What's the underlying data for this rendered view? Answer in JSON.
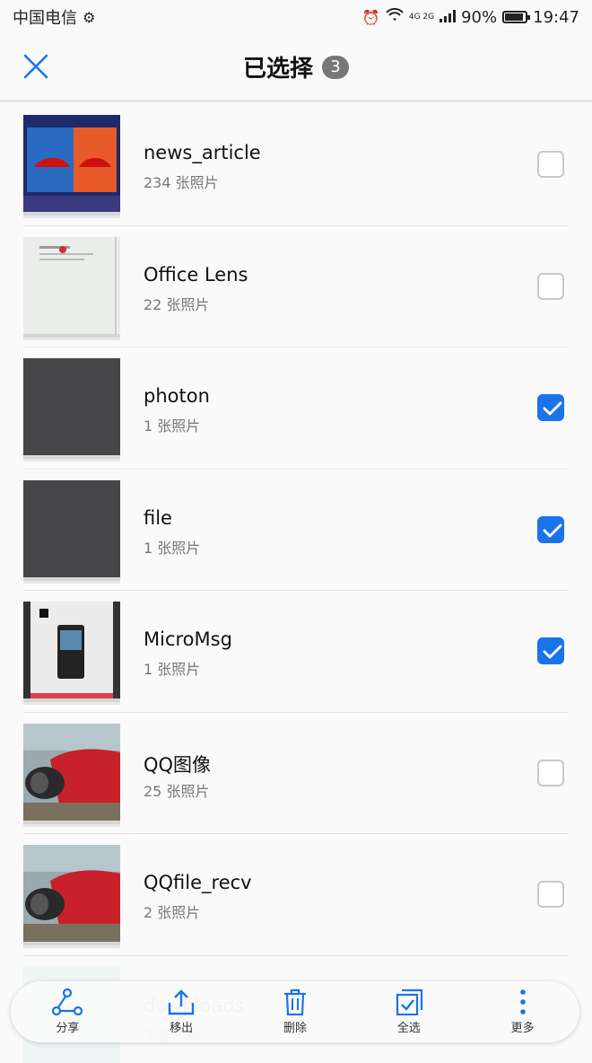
{
  "status_bar": {
    "carrier": "中国电信",
    "network": "4G 2G",
    "battery": "90%",
    "battery_level": 0.9,
    "time": "19:47"
  },
  "header": {
    "title": "已选择",
    "selected_count": "3"
  },
  "albums": [
    {
      "name": "news_article",
      "count": "234 张照片",
      "checked": false,
      "thumb": "car-expo"
    },
    {
      "name": "Office Lens",
      "count": "22 张照片",
      "checked": false,
      "thumb": "document"
    },
    {
      "name": "photon",
      "count": "1 张照片",
      "checked": true,
      "thumb": "dark"
    },
    {
      "name": "file",
      "count": "1 张照片",
      "checked": true,
      "thumb": "dark"
    },
    {
      "name": "MicroMsg",
      "count": "1 张照片",
      "checked": true,
      "thumb": "phone"
    },
    {
      "name": "QQ图像",
      "count": "25 张照片",
      "checked": false,
      "thumb": "red-car"
    },
    {
      "name": "QQfile_recv",
      "count": "2 张照片",
      "checked": false,
      "thumb": "red-car"
    },
    {
      "name": "downloads",
      "count": "3 张照片",
      "checked": false,
      "thumb": "partial"
    }
  ],
  "bottom_bar": {
    "share": "分享",
    "move_out": "移出",
    "delete": "删除",
    "select_all": "全选",
    "more": "更多"
  },
  "colors": {
    "accent": "#1a73e8",
    "badge": "#777777"
  }
}
